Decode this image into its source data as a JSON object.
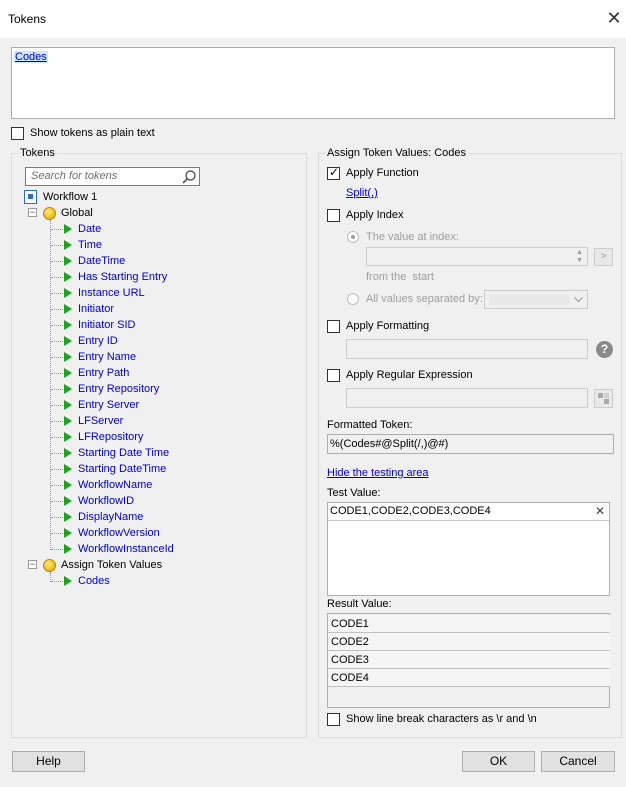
{
  "window": {
    "title": "Tokens",
    "close_glyph": "✕"
  },
  "editor": {
    "token_text": "Codes"
  },
  "show_plain": {
    "label": "Show tokens as plain text",
    "checked": false
  },
  "tokens_panel": {
    "title": "Tokens",
    "search_placeholder": "Search for tokens",
    "root": "Workflow 1",
    "global_label": "Global",
    "global_items": [
      "Date",
      "Time",
      "DateTime",
      "Has Starting Entry",
      "Instance URL",
      "Initiator",
      "Initiator SID",
      "Entry ID",
      "Entry Name",
      "Entry Path",
      "Entry Repository",
      "Entry Server",
      "LFServer",
      "LFRepository",
      "Starting Date Time",
      "Starting DateTime",
      "WorkflowName",
      "WorkflowID",
      "DisplayName",
      "WorkflowVersion",
      "WorkflowInstanceId"
    ],
    "assign_label": "Assign Token Values",
    "assign_items": [
      "Codes"
    ]
  },
  "assign_panel": {
    "title": "Assign Token Values: Codes",
    "apply_function": {
      "label": "Apply Function",
      "checked": true,
      "link": "Split(,)"
    },
    "apply_index": {
      "label": "Apply Index",
      "checked": false,
      "value_at_index_label": "The value at index:",
      "from_label": "from the",
      "from_value": "start",
      "all_values_label": "All values separated by:",
      "go_button": ">"
    },
    "apply_formatting": {
      "label": "Apply Formatting",
      "help": "?"
    },
    "apply_regex": {
      "label": "Apply Regular Expression"
    },
    "formatted_token": {
      "label": "Formatted Token:",
      "value": "%(Codes#@Split(/,)@#)"
    },
    "hide_testing_link": "Hide the testing area",
    "test_value": {
      "label": "Test Value:",
      "value": "CODE1,CODE2,CODE3,CODE4",
      "clear_glyph": "✕"
    },
    "result_value": {
      "label": "Result Value:",
      "rows": [
        "CODE1",
        "CODE2",
        "CODE3",
        "CODE4"
      ]
    },
    "line_break": {
      "label": "Show line break characters as \\r and \\n",
      "checked": false
    }
  },
  "buttons": {
    "help": "Help",
    "ok": "OK",
    "cancel": "Cancel"
  },
  "colors": {
    "link": "#0000cc",
    "tree_icon_green": "#1ea21e",
    "selection": "#cce8ff"
  }
}
